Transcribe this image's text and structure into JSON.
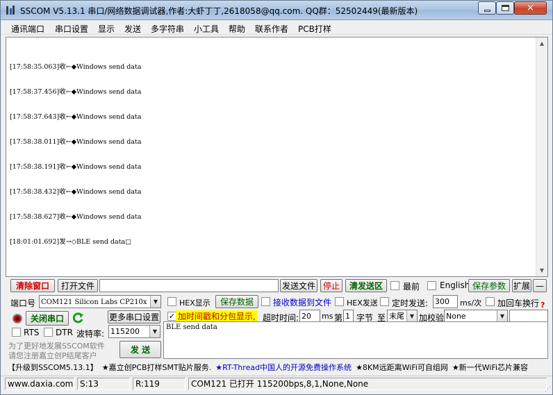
{
  "title": "SSCOM V5.13.1 串口/网络数据调试器,作者:大虾丁丁,2618058@qq.com. QQ群：52502449(最新版本)",
  "menu": [
    "通讯端口",
    "串口设置",
    "显示",
    "发送",
    "多字符串",
    "小工具",
    "帮助",
    "联系作者",
    "PCB打样"
  ],
  "receive": {
    "lines": [
      "[17:58:35.063]收←◆Windows send data",
      "[17:58:37.456]收←◆Windows send data",
      "[17:58:37.643]收←◆Windows send data",
      "[17:58:38.011]收←◆Windows send data",
      "[17:58:38.191]收←◆Windows send data",
      "[17:58:38.432]收←◆Windows send data",
      "[17:58:38.627]收←◆Windows send data",
      "[18:01:01.692]发→◇BLE send data□"
    ]
  },
  "toolbar": {
    "clear_window": "清除窗口",
    "open_file": "打开文件",
    "file_path": "",
    "send_file": "发送文件",
    "stop": "停止",
    "clear_send": "清发送区",
    "topmost": "最前",
    "english": "English",
    "save_params": "保存参数",
    "expand": "扩展",
    "collapse": "—"
  },
  "port": {
    "port_label": "端口号",
    "port_value": "COM121 Silicon Labs CP210x",
    "hex_display": "HEX显示",
    "save_data": "保存数据",
    "recv_to_file": "接收数据到文件",
    "hex_send": "HEX发送",
    "timed_send": "定时发送:",
    "timed_ms": "300",
    "ms_per": "ms/次",
    "add_crlf": "加回车换行",
    "help_mark": "?",
    "close_port": "关闭串口",
    "more_settings": "更多串口设置",
    "timestamp": "加时间戳和分包显示,",
    "timeout_label": "超时时间:",
    "timeout_value": "20",
    "ms": "ms",
    "nth_label": "第",
    "nth_value": "1",
    "byte_label": "字节",
    "to_label": "至",
    "end_value": "末尾",
    "checksum_label": "加校验",
    "checksum_value": "None",
    "rts": "RTS",
    "dtr": "DTR",
    "baud_label": "波特率:",
    "baud_value": "115200",
    "promo_line1": "为了更好地发展SSCOM软件",
    "promo_line2": "请您注册嘉立创P结尾客户",
    "send_button": "发 送"
  },
  "send": {
    "text": "BLE send data"
  },
  "promo": [
    "【升级到SSCOM5.13.1】",
    "★嘉立创PCB打样SMT贴片服务.",
    "★RT-Thread中国人的开源免费操作系统",
    "★8KM远距离WiFi可自组网",
    "★新一代WiFi芯片兼容"
  ],
  "status": {
    "site": "www.daxia.com",
    "sent": "S:13",
    "received": "R:119",
    "port_state": "COM121 已打开  115200bps,8,1,None,None"
  },
  "colors": {
    "accent_red": "#d40000",
    "accent_green": "#006600",
    "link_blue": "#0000c0",
    "timestamp_bg": "#ffff00"
  }
}
